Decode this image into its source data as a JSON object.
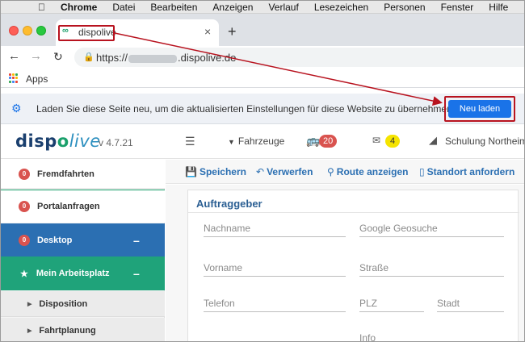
{
  "menubar": {
    "items": [
      "Chrome",
      "Datei",
      "Bearbeiten",
      "Anzeigen",
      "Verlauf",
      "Lesezeichen",
      "Personen",
      "Fenster",
      "Hilfe"
    ]
  },
  "browser": {
    "tab_title": "dispolive",
    "url_prefix": "https://",
    "url_suffix": ".dispolive.de",
    "bookmark_apps": "Apps"
  },
  "infobar": {
    "message": "Laden Sie diese Seite neu, um die aktualisierten Einstellungen für diese Website zu übernehmen",
    "button_label": "Neu laden"
  },
  "app": {
    "logo_dispo_d": "disp",
    "logo_o": "o",
    "logo_live": "live",
    "version": "v 4.7.21",
    "vehicles_label": "Fahrzeuge",
    "bus_count": "20",
    "mail_count": "4",
    "school_label": "Schulung Northeim"
  },
  "sidebar": {
    "items": [
      {
        "count": "0",
        "label": "Fremdfahrten"
      },
      {
        "count": "0",
        "label": "Portalanfragen"
      },
      {
        "count": "0",
        "label": "Desktop",
        "toggle": "–"
      },
      {
        "label": "Mein Arbeitsplatz",
        "toggle": "–"
      }
    ],
    "subitems": [
      "Disposition",
      "Fahrtplanung"
    ]
  },
  "toolbar": {
    "save": "Speichern",
    "discard": "Verwerfen",
    "route": "Route anzeigen",
    "location": "Standort anfordern"
  },
  "form": {
    "title": "Auftraggeber",
    "fields": {
      "lastname": "Nachname",
      "geo": "Google Geosuche",
      "firstname": "Vorname",
      "street": "Straße",
      "phone": "Telefon",
      "zip": "PLZ",
      "city": "Stadt",
      "info": "Info"
    }
  },
  "colors": {
    "annotation_red": "#b8131f",
    "brand_blue": "#2b6fb2",
    "brand_green": "#1fa37a",
    "chrome_blue": "#1a73e8"
  }
}
